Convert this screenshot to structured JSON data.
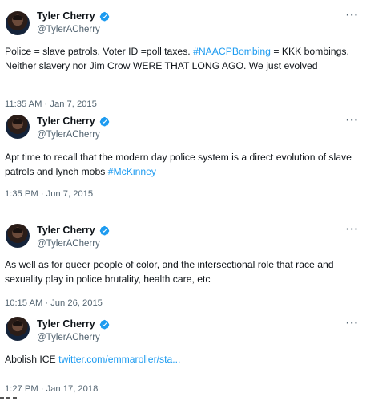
{
  "tweets": [
    {
      "name": "Tyler Cherry",
      "handle": "@TylerACherry",
      "text_parts": [
        "Police = slave patrols. Voter ID =poll taxes. ",
        "#NAACPBombing",
        " = KKK bombings. Neither slavery nor Jim Crow WERE THAT LONG AGO. We just evolved"
      ],
      "timestamp": "11:35 AM · Jan 7, 2015"
    },
    {
      "name": "Tyler Cherry",
      "handle": "@TylerACherry",
      "text_parts": [
        "Apt time to recall that the modern day police system is a direct evolution of slave patrols and lynch mobs ",
        "#McKinney"
      ],
      "timestamp": "1:35 PM · Jun 7, 2015"
    },
    {
      "name": "Tyler Cherry",
      "handle": "@TylerACherry",
      "text_parts": [
        "As well as for queer people of color, and the intersectional role that race and sexuality play in police brutality, health care, etc"
      ],
      "timestamp": "10:15 AM · Jun 26, 2015"
    },
    {
      "name": "Tyler Cherry",
      "handle": "@TylerACherry",
      "text_parts": [
        "Abolish ICE ",
        "twitter.com/emmaroller/sta..."
      ],
      "timestamp": "1:27 PM · Jan 17, 2018"
    }
  ],
  "more_label": "···",
  "colors": {
    "link": "#1d9bf0",
    "verified": "#1d9bf0",
    "secondary_text": "#536471"
  },
  "icons": {
    "verified": "verified-badge-icon",
    "more": "more-options-icon"
  }
}
